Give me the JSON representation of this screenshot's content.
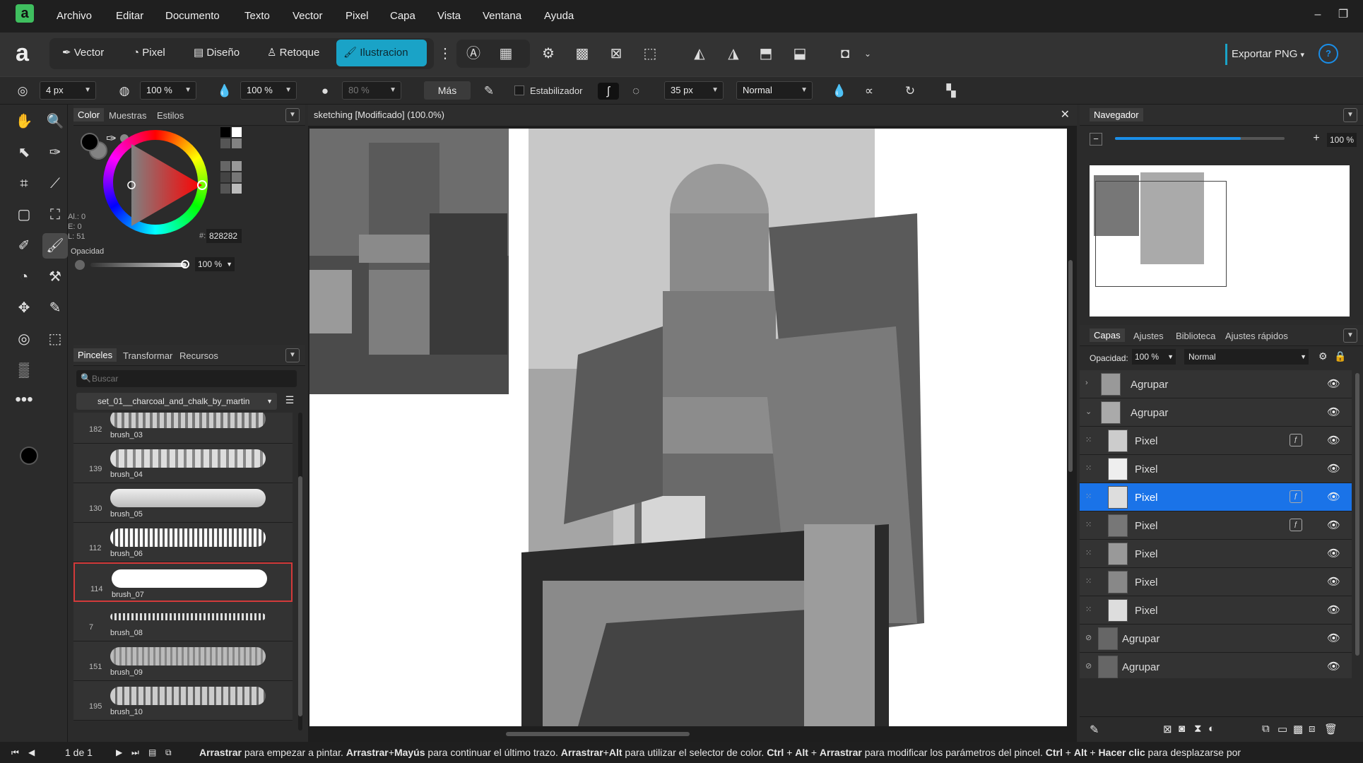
{
  "menu": {
    "items": [
      "Archivo",
      "Editar",
      "Documento",
      "Texto",
      "Vector",
      "Pixel",
      "Capa",
      "Vista",
      "Ventana",
      "Ayuda"
    ]
  },
  "personas": {
    "vector": "Vector",
    "pixel": "Pixel",
    "design": "Diseño",
    "retouch": "Retoque",
    "illustration": "Ilustracion"
  },
  "export": {
    "label": "Exportar PNG"
  },
  "context": {
    "size": "4 px",
    "opacity1": "100 %",
    "flow": "100 %",
    "hardness": "80 %",
    "more": "Más",
    "stabilizer": "Estabilizador",
    "width": "35 px",
    "blend": "Normal"
  },
  "colorpanel": {
    "tabs": [
      "Color",
      "Muestras",
      "Estilos"
    ],
    "al": "Al.: 0",
    "e": "E: 0",
    "l": "L: 51",
    "hex_prefix": "#:",
    "hex": "828282",
    "opacity_label": "Opacidad",
    "opacity": "100 %"
  },
  "brushpanel": {
    "tabs": [
      "Pinceles",
      "Transformar",
      "Recursos"
    ],
    "search_placeholder": "Buscar",
    "category": "set_01__charcoal_and_chalk_by_martin",
    "brushes": [
      {
        "num": "182",
        "name": "brush_03"
      },
      {
        "num": "139",
        "name": "brush_04"
      },
      {
        "num": "130",
        "name": "brush_05"
      },
      {
        "num": "112",
        "name": "brush_06"
      },
      {
        "num": "114",
        "name": "brush_07"
      },
      {
        "num": "7",
        "name": "brush_08"
      },
      {
        "num": "151",
        "name": "brush_09"
      },
      {
        "num": "195",
        "name": "brush_10"
      }
    ]
  },
  "document": {
    "title": "sketching [Modificado] (100.0%)"
  },
  "navigator": {
    "title": "Navegador",
    "zoom": "100 %",
    "zoom_fraction": 0.74
  },
  "layers": {
    "tabs": [
      "Capas",
      "Ajustes",
      "Biblioteca",
      "Ajustes rápidos"
    ],
    "opacity_label": "Opacidad:",
    "opacity": "100 %",
    "blend": "Normal",
    "rows": [
      {
        "name": "Agrupar"
      },
      {
        "name": "Agrupar"
      },
      {
        "name": "Pixel"
      },
      {
        "name": "Pixel"
      },
      {
        "name": "Pixel"
      },
      {
        "name": "Pixel"
      },
      {
        "name": "Pixel"
      },
      {
        "name": "Pixel"
      },
      {
        "name": "Pixel"
      },
      {
        "name": "Agrupar"
      },
      {
        "name": "Agrupar"
      }
    ]
  },
  "status": {
    "page": "1 de 1",
    "hint": [
      {
        "b": "Arrastrar",
        "t": " para empezar a pintar. "
      },
      {
        "b": "Arrastrar",
        "t": "+"
      },
      {
        "b": "Mayús",
        "t": " para continuar el último trazo. "
      },
      {
        "b": "Arrastrar",
        "t": "+"
      },
      {
        "b": "Alt",
        "t": " para utilizar el selector de color. "
      },
      {
        "b": "Ctrl",
        "t": " + "
      },
      {
        "b": "Alt",
        "t": " + "
      },
      {
        "b": "Arrastrar",
        "t": " para modificar los parámetros del pincel. "
      },
      {
        "b": "Ctrl",
        "t": " + "
      },
      {
        "b": "Alt",
        "t": " + "
      },
      {
        "b": "Hacer clic",
        "t": " para desplazarse por"
      }
    ]
  },
  "colors": {
    "accent": "#1aa3c7",
    "selection": "#1a73e8",
    "brush_selected_border": "#d23a3a"
  }
}
